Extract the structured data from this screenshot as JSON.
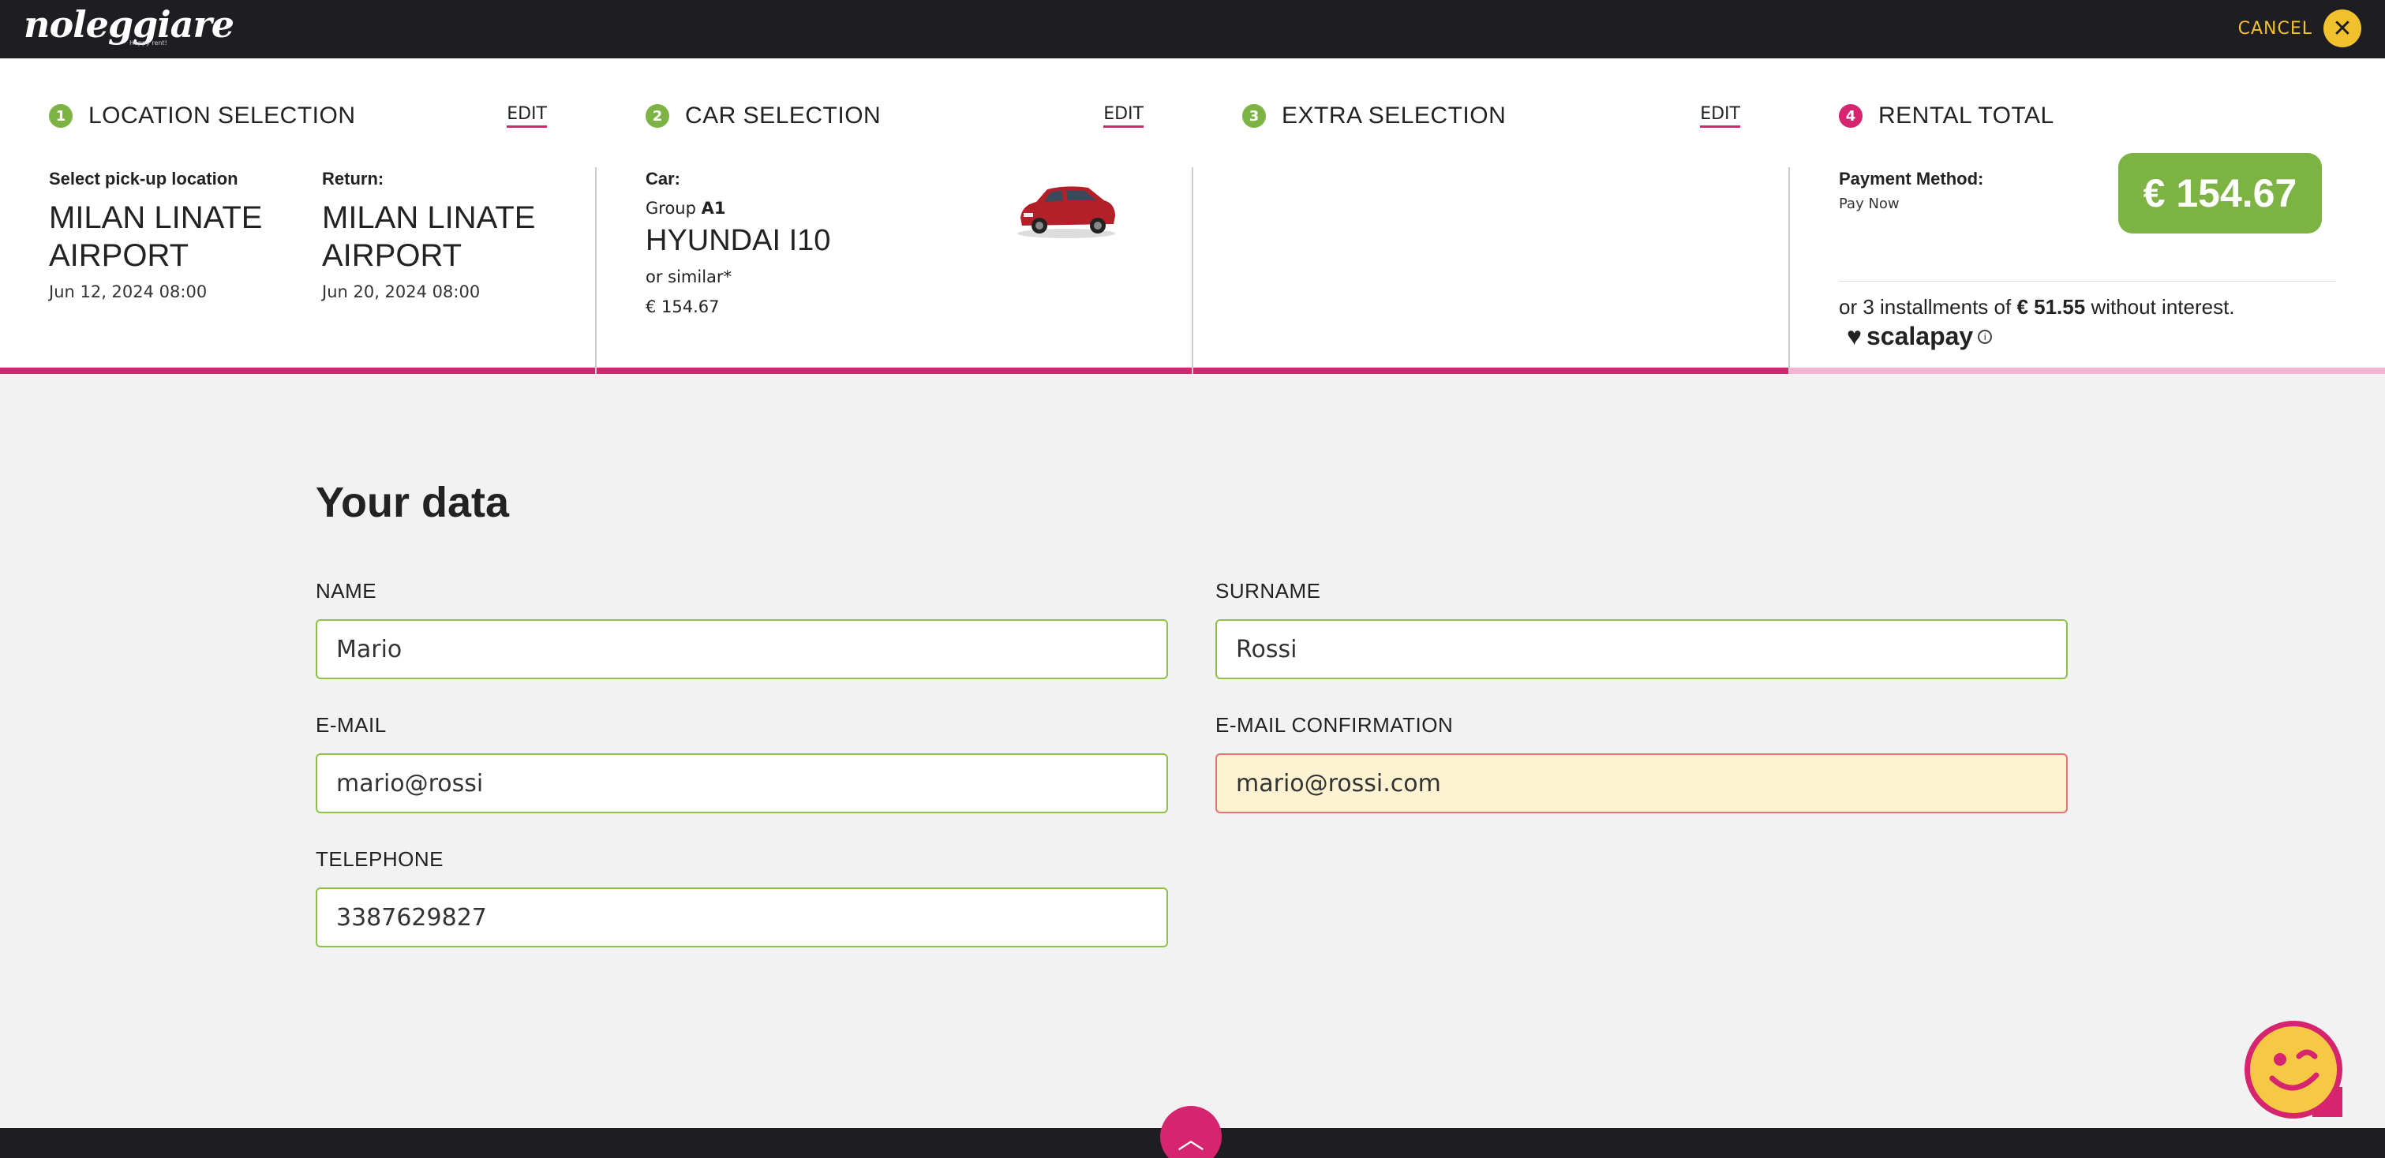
{
  "header": {
    "logo_text": "noleggiare",
    "logo_tagline": "Happy rent!",
    "cancel_label": "CANCEL",
    "cancel_icon": "close-icon"
  },
  "steps": [
    {
      "number": "1",
      "title": "LOCATION SELECTION",
      "edit": "EDIT",
      "state": "done",
      "color": "#7cb342"
    },
    {
      "number": "2",
      "title": "CAR SELECTION",
      "edit": "EDIT",
      "state": "done",
      "color": "#7cb342"
    },
    {
      "number": "3",
      "title": "EXTRA SELECTION",
      "edit": "EDIT",
      "state": "done",
      "color": "#7cb342"
    },
    {
      "number": "4",
      "title": "RENTAL TOTAL",
      "state": "current",
      "color": "#d6246e"
    }
  ],
  "location": {
    "pickup_label": "Select pick-up location",
    "pickup_place": "MILAN LINATE AIRPORT",
    "pickup_date": "Jun 12, 2024 08:00",
    "return_label": "Return:",
    "return_place": "MILAN LINATE AIRPORT",
    "return_date": "Jun 20, 2024 08:00"
  },
  "car": {
    "label": "Car:",
    "group_prefix": "Group",
    "group": "A1",
    "name": "HYUNDAI I10",
    "similar": "or similar*",
    "price": "€ 154.67",
    "image_icon": "red-car-image"
  },
  "total": {
    "payment_label": "Payment Method:",
    "payment_value": "Pay Now",
    "price": "€ 154.67",
    "installments_prefix": "or 3 installments of",
    "installments_amount": "€ 51.55",
    "installments_suffix": "without interest.",
    "scalapay": "scalapay"
  },
  "form": {
    "title": "Your data",
    "name_label": "NAME",
    "name_value": "Mario",
    "surname_label": "SURNAME",
    "surname_value": "Rossi",
    "email_label": "E-MAIL",
    "email_value": "mario@rossi",
    "email_confirm_label": "E-MAIL CONFIRMATION",
    "email_confirm_value": "mario@rossi.com",
    "telephone_label": "TELEPHONE",
    "telephone_value": "3387629827"
  },
  "colors": {
    "accent_pink": "#d6246e",
    "accent_green": "#7cb342",
    "cancel_yellow": "#f2c12e",
    "dark_bar": "#1e1e22"
  }
}
